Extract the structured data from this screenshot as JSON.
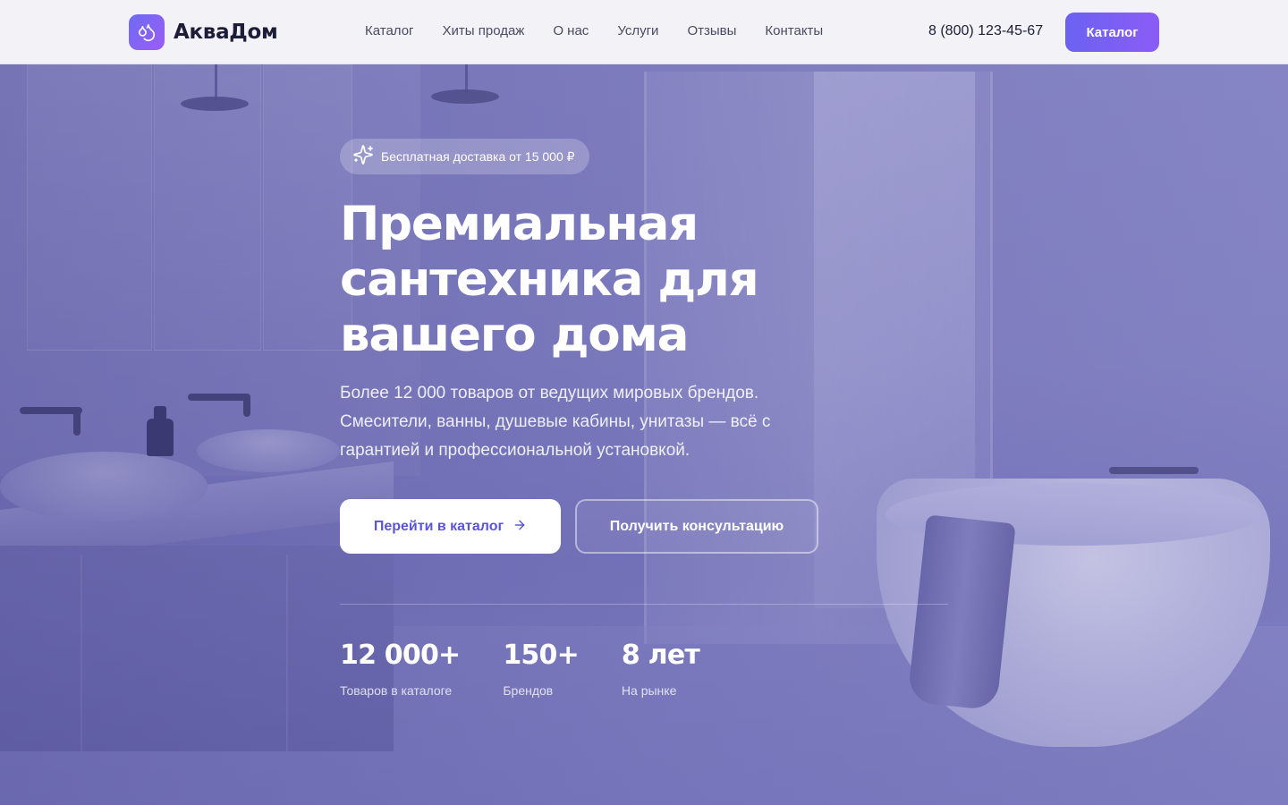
{
  "header": {
    "logo_text": "АкваДом",
    "nav": [
      "Каталог",
      "Хиты продаж",
      "О нас",
      "Услуги",
      "Отзывы",
      "Контакты"
    ],
    "phone": "8 (800) 123-45-67",
    "catalog_button": "Каталог"
  },
  "hero": {
    "badge": "Бесплатная доставка от 15 000 ₽",
    "title": "Премиальная сантехника для вашего дома",
    "subtitle": "Более 12 000 товаров от ведущих мировых брендов. Смесители, ванны, душевые кабины, унитазы — всё с гарантией и профессиональной установкой.",
    "primary_button": "Перейти в каталог",
    "secondary_button": "Получить консультацию",
    "stats": [
      {
        "value": "12 000+",
        "label": "Товаров в каталоге"
      },
      {
        "value": "150+",
        "label": "Брендов"
      },
      {
        "value": "8 лет",
        "label": "На рынке"
      }
    ]
  },
  "icons": {
    "logo": "water-drops-icon",
    "badge": "sparkles-icon",
    "primary_button": "arrow-right-icon"
  },
  "colors": {
    "accent": "#6b62f2",
    "accent_end": "#8b5cf6",
    "header_bg": "#f3f3f7",
    "hero_tint": "#6b6bb8"
  }
}
